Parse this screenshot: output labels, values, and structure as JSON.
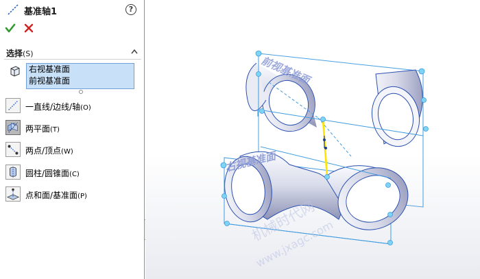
{
  "panel": {
    "title": "基准轴1",
    "help_label": "?",
    "selection_group": {
      "title": "选择",
      "shortcut": "(S)",
      "items": [
        "右视基准面",
        "前视基准面"
      ]
    },
    "options": [
      {
        "label": "一直线/边线/轴",
        "key": "(O)",
        "icon": "line-edge-axis-icon",
        "active": false
      },
      {
        "label": "两平面",
        "key": "(T)",
        "icon": "two-planes-icon",
        "active": true
      },
      {
        "label": "两点/顶点",
        "key": "(W)",
        "icon": "two-points-icon",
        "active": false
      },
      {
        "label": "圆柱/圆锥面",
        "key": "(C)",
        "icon": "cylinder-cone-face-icon",
        "active": false
      },
      {
        "label": "点和面/基准面",
        "key": "(P)",
        "icon": "point-plane-icon",
        "active": false
      }
    ]
  },
  "viewport": {
    "plane_label": "右视基准面",
    "plane_label_top": "前视基准面",
    "watermark_cn": "机械时代网",
    "watermark_url": "www.jxagc.com",
    "colors": {
      "plane_edge": "#3f9be0",
      "axis": "#ffe400",
      "model_edge": "#2a4fb0",
      "handle": "#7fd4f4"
    }
  }
}
